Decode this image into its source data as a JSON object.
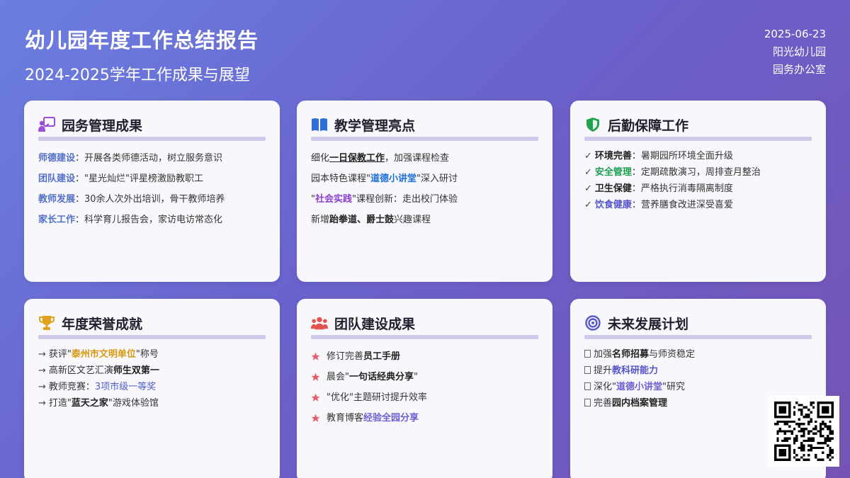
{
  "header": {
    "title": "幼儿园年度工作总结报告",
    "subtitle": "2024-2025学年工作成果与展望",
    "date": "2025-06-23",
    "org": "阳光幼儿园",
    "dept": "园务办公室"
  },
  "colors": {
    "background_start": "#6b7fe0",
    "background_end": "#7553b4",
    "card_bg": "#f8f8fc",
    "rule": "#cfcbea",
    "keyword_blue": "#5470c6",
    "keyword_green": "#1fa050",
    "keyword_gold": "#d59a12",
    "star_red": "#e85d68"
  },
  "cards": [
    {
      "title": "园务管理成果",
      "icon": "presentation-icon",
      "items": [
        {
          "k": "师德建设",
          "t": "：开展各类师德活动，树立服务意识"
        },
        {
          "k": "团队建设",
          "t": "：\"星光灿烂\"评星榜激励教职工"
        },
        {
          "k": "教师发展",
          "t": "：30余人次外出培训，骨干教师培养"
        },
        {
          "k": "家长工作",
          "t": "：科学育儿报告会，家访电访常态化"
        }
      ]
    },
    {
      "title": "教学管理亮点",
      "icon": "book-icon",
      "items": [
        {
          "a": "细化",
          "k": "一日保教工作",
          "b": "，加强课程检查"
        },
        {
          "a": "园本特色课程\"",
          "k": "道德小讲堂",
          "b": "\"深入研讨"
        },
        {
          "a": "\"",
          "k": "社会实践",
          "b": "\"课程创新：走出校门体验"
        },
        {
          "a": "新增",
          "k": "跆拳道、爵士鼓",
          "b": "兴趣课程"
        }
      ]
    },
    {
      "title": "后勤保障工作",
      "icon": "shield-icon",
      "items": [
        {
          "m": "✓",
          "k": "环境完善",
          "t": "：暑期园所环境全面升级"
        },
        {
          "m": "✓",
          "k": "安全管理",
          "t": "：定期疏散演习，周排查月整治"
        },
        {
          "m": "✓",
          "k": "卫生保健",
          "t": "：严格执行消毒隔离制度"
        },
        {
          "m": "✓",
          "k": "饮食健康",
          "t": "：营养膳食改进深受喜爱"
        }
      ]
    },
    {
      "title": "年度荣誉成就",
      "icon": "trophy-icon",
      "items": [
        {
          "m": "→",
          "a": "获评\"",
          "k": "泰州市文明单位",
          "b": "\"称号"
        },
        {
          "m": "→",
          "a": "高新区文艺汇演",
          "k": "师生双第一",
          "b": ""
        },
        {
          "m": "→",
          "a": "教师竞赛：",
          "k": "3项市级一等奖",
          "b": ""
        },
        {
          "m": "→",
          "a": "打造\"",
          "k": "蓝天之家",
          "b": "\"游戏体验馆"
        }
      ]
    },
    {
      "title": "团队建设成果",
      "icon": "users-icon",
      "items": [
        {
          "a": "修订完善",
          "k": "员工手册",
          "b": ""
        },
        {
          "a": "晨会\"",
          "k": "一句话经典分享",
          "b": "\""
        },
        {
          "a": "\"优化\"主题研讨提升效率",
          "k": "",
          "b": ""
        },
        {
          "a": "教育博客",
          "k": "经验全园分享",
          "b": ""
        }
      ]
    },
    {
      "title": "未来发展计划",
      "icon": "target-icon",
      "items": [
        {
          "a": "加强",
          "k": "名师招募",
          "b": "与师资稳定"
        },
        {
          "a": "提升",
          "k": "教科研能力",
          "b": ""
        },
        {
          "a": "深化\"",
          "k": "道德小讲堂",
          "b": "\"研究"
        },
        {
          "a": "完善",
          "k": "园内档案管理",
          "b": ""
        }
      ]
    }
  ]
}
